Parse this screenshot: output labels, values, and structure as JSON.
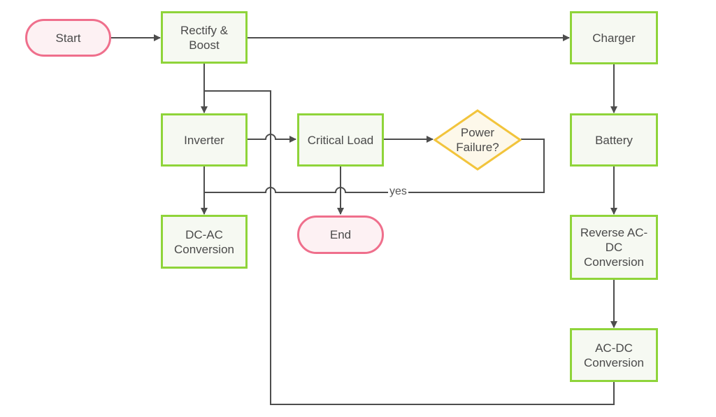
{
  "diagram": {
    "nodes": {
      "start": {
        "label": "Start",
        "shape": "terminal"
      },
      "rectify": {
        "label": "Rectify &\nBoost",
        "shape": "process"
      },
      "charger": {
        "label": "Charger",
        "shape": "process"
      },
      "inverter": {
        "label": "Inverter",
        "shape": "process"
      },
      "critical_load": {
        "label": "Critical Load",
        "shape": "process"
      },
      "power_failure": {
        "label": "Power\nFailure?",
        "shape": "decision"
      },
      "battery": {
        "label": "Battery",
        "shape": "process"
      },
      "dc_ac": {
        "label": "DC-AC\nConversion",
        "shape": "process"
      },
      "end": {
        "label": "End",
        "shape": "terminal"
      },
      "reverse_ac_dc": {
        "label": "Reverse AC-\nDC\nConversion",
        "shape": "process"
      },
      "ac_dc": {
        "label": "AC-DC\nConversion",
        "shape": "process"
      }
    },
    "edges": [
      {
        "from": "start",
        "to": "rectify",
        "label": ""
      },
      {
        "from": "rectify",
        "to": "charger",
        "label": ""
      },
      {
        "from": "rectify",
        "to": "inverter",
        "label": ""
      },
      {
        "from": "inverter",
        "to": "critical_load",
        "label": ""
      },
      {
        "from": "inverter",
        "to": "dc_ac",
        "label": ""
      },
      {
        "from": "critical_load",
        "to": "power_failure",
        "label": ""
      },
      {
        "from": "critical_load",
        "to": "end",
        "label": ""
      },
      {
        "from": "power_failure",
        "to": "dc_ac",
        "label": "yes"
      },
      {
        "from": "charger",
        "to": "battery",
        "label": ""
      },
      {
        "from": "battery",
        "to": "reverse_ac_dc",
        "label": ""
      },
      {
        "from": "reverse_ac_dc",
        "to": "ac_dc",
        "label": ""
      },
      {
        "from": "ac_dc",
        "to": "rectify",
        "label": ""
      }
    ],
    "colors": {
      "process_border": "#8fd43a",
      "process_fill": "#f6f9f2",
      "terminal_border": "#ef6f8c",
      "terminal_fill": "#fdf1f3",
      "decision_border": "#f2c43c",
      "decision_fill": "#fdf8ea",
      "edge": "#4d4d4d"
    }
  }
}
